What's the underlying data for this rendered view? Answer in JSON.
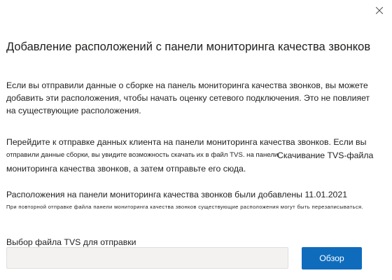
{
  "dialog": {
    "title": "Добавление расположений с панели мониторинга качества звонков",
    "close_icon": "close-icon",
    "paragraph1": "Если вы отправили данные о сборке на панель мониторинга качества звонков, вы можете добавить эти расположения, чтобы начать оценку сетевого подключения. Это не повлияет на существующие расположения.",
    "paragraph2_line1": "Перейдите к отправке данных клиента на панели мониторинга качества звонков. Если вы",
    "paragraph2_small": "отправили данные сборки, вы увидите возможность скачать их в файл TVS. на панели",
    "paragraph2_link": "Скачивание TVS-файла",
    "paragraph2_line3": "мониторинга качества звонков, а затем отправьте его сюда.",
    "status_text": "Расположения на панели мониторинга качества звонков были добавлены 11.01.2021",
    "warning_text": "При повторной отправке файла панели мониторинга качества звонков существующие расположения могут быть перезаписываться.",
    "file_label": "Выбор файла TVS для отправки",
    "file_input_value": "",
    "browse_label": "Обзор"
  },
  "colors": {
    "accent": "#0f6cbd",
    "text": "#201f1e",
    "input_bg": "#f3f2f1"
  }
}
